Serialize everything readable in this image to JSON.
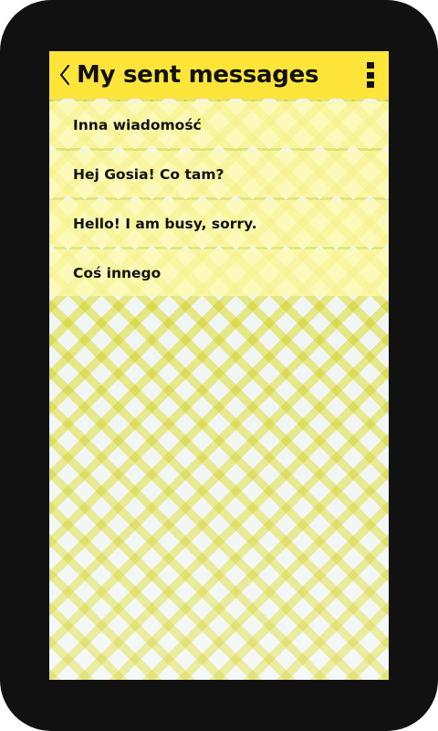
{
  "header": {
    "title": "My sent messages",
    "back_icon": "chevron-left-icon",
    "menu_icon": "overflow-menu-icon"
  },
  "messages": [
    {
      "text": "Inna wiadomość"
    },
    {
      "text": "Hej Gosia! Co tam?"
    },
    {
      "text": "Hello! I am busy, sorry."
    },
    {
      "text": "Coś innego"
    }
  ],
  "colors": {
    "header_bg": "#ffe53a",
    "row_bg": "#fffaaa",
    "device_frame": "#111111"
  }
}
